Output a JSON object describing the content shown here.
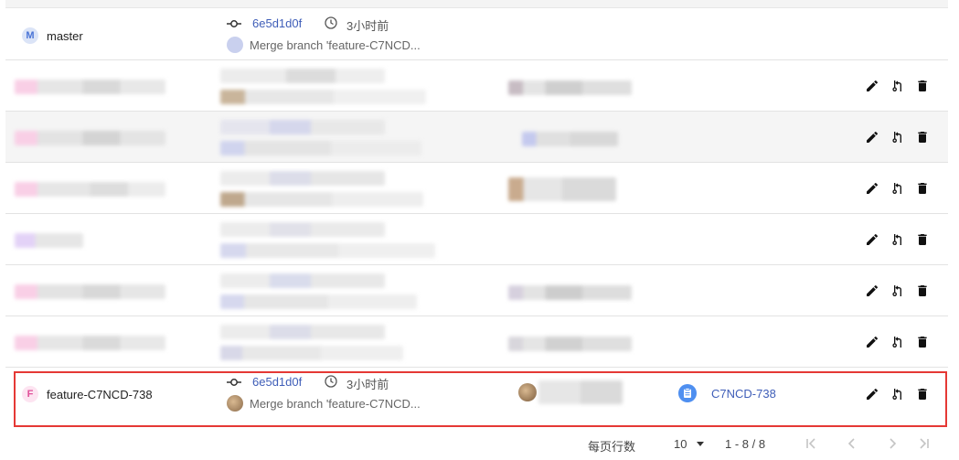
{
  "rows": [
    {
      "branch": {
        "avatar_letter": "M",
        "name": "master",
        "avatar_bg": "#dbe4f7",
        "avatar_fg": "#4a74d6"
      },
      "commit": {
        "hash": "6e5d1d0f",
        "time": "3小时前",
        "message": "Merge branch 'feature-C7NCD..."
      }
    },
    {
      "branch": {
        "avatar_letter": "F",
        "name": "feature-C7NCD-738",
        "avatar_bg": "#fde4f1",
        "avatar_fg": "#e0509a"
      },
      "commit": {
        "hash": "6e5d1d0f",
        "time": "3小时前",
        "message": "Merge branch 'feature-C7NCD..."
      },
      "issue": {
        "name": "C7NCD-738"
      }
    }
  ],
  "pagination": {
    "rows_per_page_label": "每页行数",
    "rows_per_page": "10",
    "range": "1 - 8 / 8"
  },
  "colors": {
    "accent": "#3f5eb8",
    "highlight": "#e53935"
  }
}
